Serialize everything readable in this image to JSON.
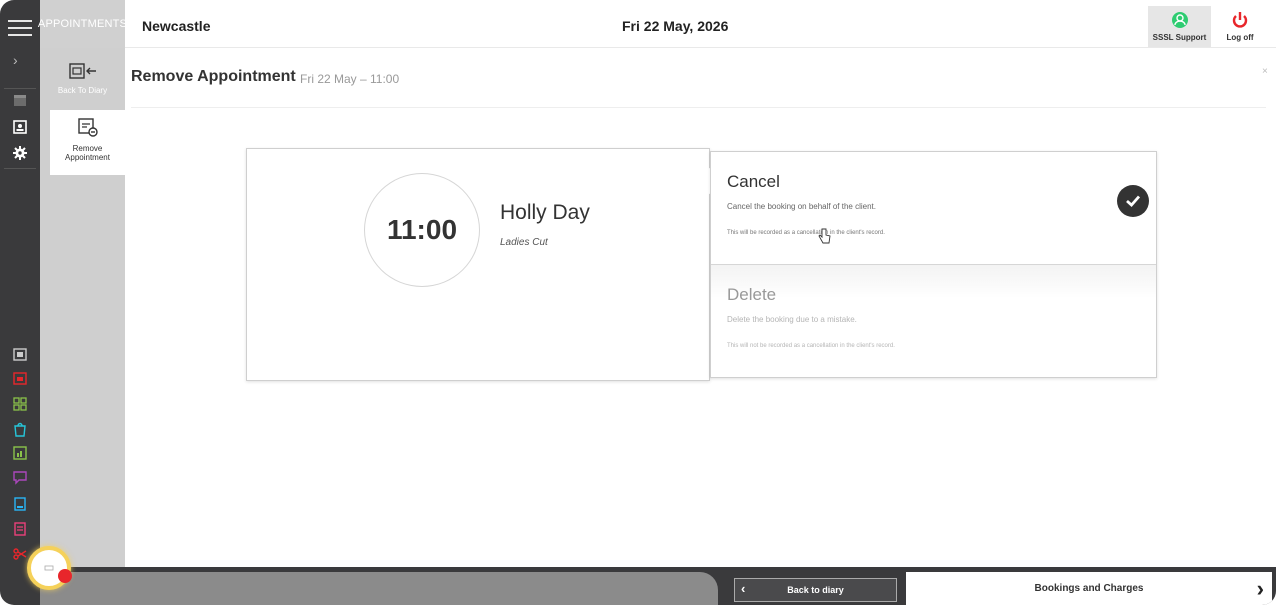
{
  "sidebar": {
    "section_title": "APPOINTMENTS",
    "items": [
      {
        "label": "Back To Diary",
        "icon": "calendar-back-icon"
      },
      {
        "label": "Remove Appointment",
        "icon": "calendar-remove-icon"
      }
    ]
  },
  "header": {
    "location": "Newcastle",
    "date": "Fri 22 May, 2026",
    "support_label": "SSSL Support",
    "logoff_label": "Log off"
  },
  "page": {
    "title": "Remove Appointment",
    "subtitle": "Fri 22 May – 11:00",
    "close": "×"
  },
  "appointment": {
    "time": "11:00",
    "client": "Holly Day",
    "service": "Ladies Cut"
  },
  "options": [
    {
      "name": "Cancel",
      "description": "Cancel the booking on behalf of the client.",
      "note": "This will be recorded as a cancellation in the client's record.",
      "selected": true
    },
    {
      "name": "Delete",
      "description": "Delete the booking due to a mistake.",
      "note": "This will not be recorded as a cancellation in the client's record.",
      "selected": false
    }
  ],
  "footer": {
    "back_label": "Back to diary",
    "bookings_label": "Bookings and Charges"
  },
  "colors": {
    "rail": "#3a3a3c",
    "subsidebar": "#cfcfcf",
    "support_accent": "#2ecc71",
    "logoff_accent": "#e8262b"
  }
}
